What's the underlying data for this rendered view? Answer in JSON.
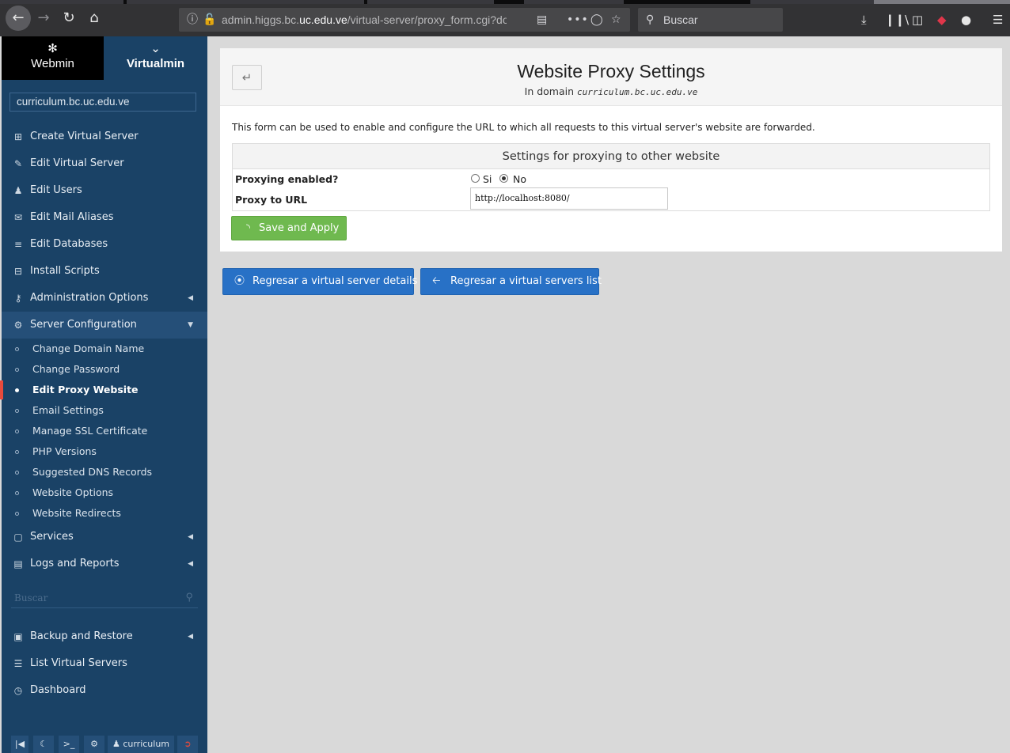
{
  "browser": {
    "url_prefix": "admin.higgs.bc.",
    "url_domain": "uc.edu.ve",
    "url_path": "/virtual-server/proxy_form.cgi?dom",
    "search_placeholder": "Buscar"
  },
  "sidebar": {
    "tabs": {
      "webmin": "Webmin",
      "virtualmin": "Virtualmin"
    },
    "domain": "curriculum.bc.uc.edu.ve",
    "items": [
      {
        "label": "Create Virtual Server",
        "icon": "plus-square-icon"
      },
      {
        "label": "Edit Virtual Server",
        "icon": "edit-icon"
      },
      {
        "label": "Edit Users",
        "icon": "users-icon"
      },
      {
        "label": "Edit Mail Aliases",
        "icon": "envelope-icon"
      },
      {
        "label": "Edit Databases",
        "icon": "database-icon"
      },
      {
        "label": "Install Scripts",
        "icon": "download-box-icon"
      },
      {
        "label": "Administration Options",
        "icon": "key-icon"
      },
      {
        "label": "Server Configuration",
        "icon": "gears-icon"
      }
    ],
    "sub_items": [
      "Change Domain Name",
      "Change Password",
      "Edit Proxy Website",
      "Email Settings",
      "Manage SSL Certificate",
      "PHP Versions",
      "Suggested DNS Records",
      "Website Options",
      "Website Redirects"
    ],
    "lower_items": [
      {
        "label": "Services",
        "icon": "puzzle-icon"
      },
      {
        "label": "Logs and Reports",
        "icon": "file-text-icon"
      }
    ],
    "search_placeholder": "Buscar",
    "bottom_items": [
      {
        "label": "Backup and Restore",
        "icon": "save-icon"
      },
      {
        "label": "List Virtual Servers",
        "icon": "server-list-icon"
      },
      {
        "label": "Dashboard",
        "icon": "dashboard-icon"
      }
    ],
    "footer_user": "curriculum"
  },
  "main": {
    "title": "Website Proxy Settings",
    "subtitle_prefix": "In domain",
    "subtitle_domain": "curriculum.bc.uc.edu.ve",
    "intro": "This form can be used to enable and configure the URL to which all requests to this virtual server's website are forwarded.",
    "section_title": "Settings for proxying to other website",
    "proxy_enabled_label": "Proxying enabled?",
    "radio_yes": "Si",
    "radio_no": "No",
    "proxy_enabled_value": "No",
    "proxy_url_label": "Proxy to URL",
    "proxy_url_value": "http://localhost:8080/",
    "save_label": "Save and Apply",
    "return_details": "Regresar a virtual server details",
    "return_list": "Regresar a virtual servers list"
  },
  "colors": {
    "sidebar_bg": "#1a4266",
    "active_marker": "#e84a3c",
    "save_button": "#6fb94f",
    "return_button": "#2871c6"
  }
}
